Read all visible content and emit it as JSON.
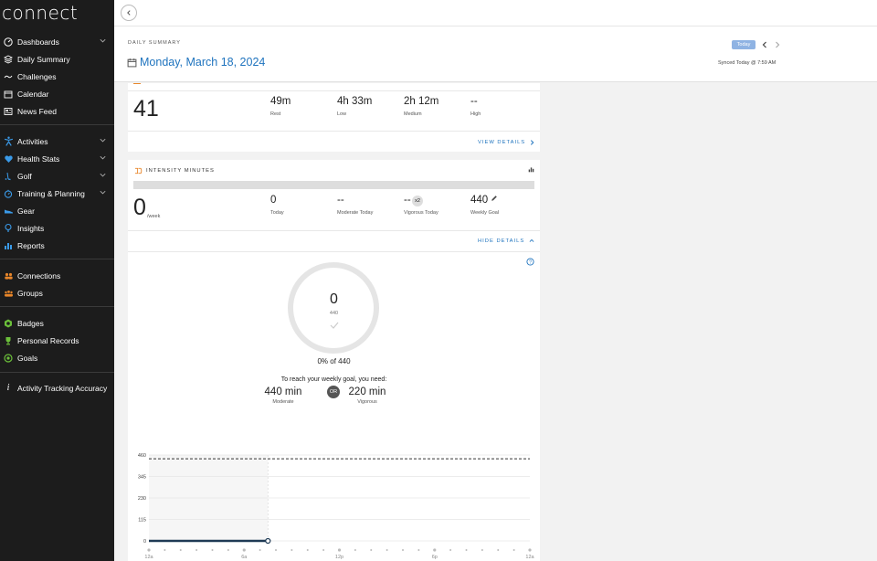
{
  "app": {
    "logo": "connect"
  },
  "sidebar": {
    "items": [
      {
        "label": "Dashboards",
        "icon": "dashboard-gauge-icon",
        "expandable": true
      },
      {
        "label": "Daily Summary",
        "icon": "layers-icon",
        "expandable": false
      },
      {
        "label": "Challenges",
        "icon": "challenges-icon",
        "expandable": false
      },
      {
        "label": "Calendar",
        "icon": "calendar-icon",
        "expandable": false
      },
      {
        "label": "News Feed",
        "icon": "news-feed-icon",
        "expandable": false
      },
      {
        "label": "Activities",
        "icon": "activity-person-icon",
        "expandable": true
      },
      {
        "label": "Health Stats",
        "icon": "heart-icon",
        "expandable": true
      },
      {
        "label": "Golf",
        "icon": "golf-icon",
        "expandable": true
      },
      {
        "label": "Training & Planning",
        "icon": "stopwatch-icon",
        "expandable": true
      },
      {
        "label": "Gear",
        "icon": "shoe-icon",
        "expandable": false
      },
      {
        "label": "Insights",
        "icon": "lightbulb-icon",
        "expandable": false
      },
      {
        "label": "Reports",
        "icon": "bar-chart-icon",
        "expandable": false
      },
      {
        "label": "Connections",
        "icon": "people-icon",
        "expandable": false
      },
      {
        "label": "Groups",
        "icon": "group-icon",
        "expandable": false
      },
      {
        "label": "Badges",
        "icon": "badge-icon",
        "expandable": false
      },
      {
        "label": "Personal Records",
        "icon": "trophy-icon",
        "expandable": false
      },
      {
        "label": "Goals",
        "icon": "target-icon",
        "expandable": false
      },
      {
        "label": "Activity Tracking Accuracy",
        "icon": "info-icon",
        "expandable": false
      }
    ]
  },
  "header": {
    "section_label": "DAILY SUMMARY",
    "date": "Monday, March 18, 2024",
    "today_badge": "Today",
    "synced": "Synced Today @ 7:59 AM"
  },
  "stress_card": {
    "value": "41",
    "stats": [
      {
        "value": "49m",
        "label": "Rest"
      },
      {
        "value": "4h 33m",
        "label": "Low"
      },
      {
        "value": "2h 12m",
        "label": "Medium"
      },
      {
        "value": "--",
        "label": "High"
      }
    ],
    "link": "VIEW DETAILS"
  },
  "intensity_card": {
    "title": "INTENSITY MINUTES",
    "value": "0",
    "unit": "/week",
    "stats": [
      {
        "value": "0",
        "label": "Today"
      },
      {
        "value": "--",
        "label": "Moderate Today"
      },
      {
        "value": "--",
        "label": "Vigorous Today",
        "badge": "x2"
      },
      {
        "value": "440",
        "label": "Weekly Goal"
      }
    ],
    "link": "HIDE DETAILS",
    "progress_fraction": 0,
    "ring": {
      "value": "0",
      "goal": "440"
    },
    "percent_text": "0% of 440",
    "need_text": "To reach your weekly goal, you need:",
    "moderate": {
      "value": "440 min",
      "label": "Moderate"
    },
    "or_label": "OR",
    "vigorous": {
      "value": "220 min",
      "label": "Vigorous"
    }
  },
  "chart_data": {
    "type": "line",
    "y_ticks": [
      0,
      115,
      230,
      345,
      460
    ],
    "ylim": [
      0,
      460
    ],
    "goal_line": 440,
    "x_tick_labels": [
      "12a",
      "6a",
      "12p",
      "6p",
      "12a"
    ],
    "x_range_hours": [
      0,
      24
    ],
    "current_hour": 7.5,
    "series": [
      {
        "values": [
          [
            0,
            0
          ],
          [
            7.5,
            0
          ]
        ]
      }
    ],
    "grid": true,
    "colors": {
      "line": "#1f3a55",
      "goal": "#333333",
      "elapsed_fill": "#f6f6f6"
    }
  }
}
